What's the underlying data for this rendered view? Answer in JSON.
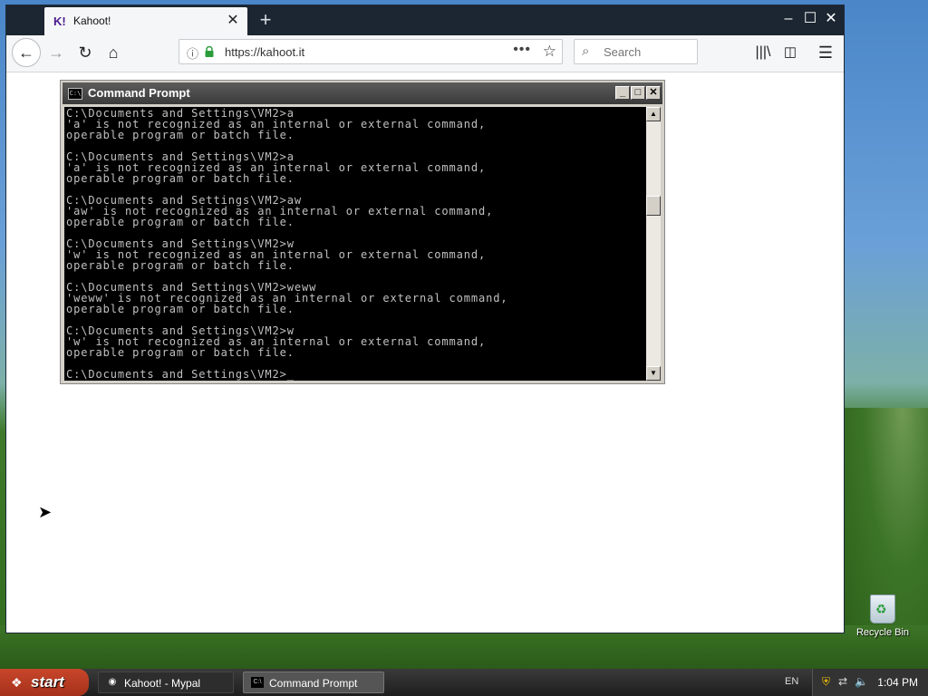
{
  "desktop": {
    "recycle_bin_label": "Recycle Bin"
  },
  "browser": {
    "tab": {
      "favicon": "K!",
      "title": "Kahoot!"
    },
    "window_controls": {
      "minimize": "–",
      "maximize": "☐",
      "close": "✕"
    },
    "url": "https://kahoot.it",
    "search_placeholder": "Search"
  },
  "cmd": {
    "title": "Command Prompt",
    "icon_text": "C:\\",
    "lines": [
      "C:\\Documents and Settings\\VM2>a",
      "'a' is not recognized as an internal or external command,",
      "operable program or batch file.",
      "",
      "C:\\Documents and Settings\\VM2>a",
      "'a' is not recognized as an internal or external command,",
      "operable program or batch file.",
      "",
      "C:\\Documents and Settings\\VM2>aw",
      "'aw' is not recognized as an internal or external command,",
      "operable program or batch file.",
      "",
      "C:\\Documents and Settings\\VM2>w",
      "'w' is not recognized as an internal or external command,",
      "operable program or batch file.",
      "",
      "C:\\Documents and Settings\\VM2>weww",
      "'weww' is not recognized as an internal or external command,",
      "operable program or batch file.",
      "",
      "C:\\Documents and Settings\\VM2>w",
      "'w' is not recognized as an internal or external command,",
      "operable program or batch file.",
      "",
      "C:\\Documents and Settings\\VM2>_"
    ]
  },
  "taskbar": {
    "start_label": "start",
    "buttons": [
      {
        "label": "Kahoot! - Mypal"
      },
      {
        "label": "Command Prompt"
      }
    ],
    "language": "EN",
    "clock": "1:04 PM"
  }
}
